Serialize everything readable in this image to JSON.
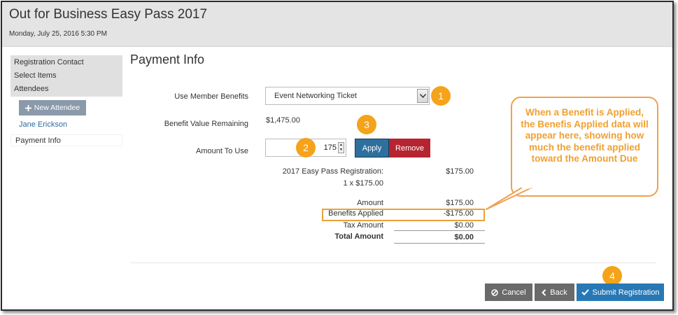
{
  "app": {
    "title": "Out for Business Easy Pass 2017",
    "datetime": "Monday, July 25, 2016 5:30 PM"
  },
  "sidebar": {
    "items": [
      {
        "label": "Registration Contact"
      },
      {
        "label": "Select Items"
      },
      {
        "label": "Attendees"
      }
    ],
    "new_attendee_label": "New Attendee",
    "attendee_name": "Jane Erickson",
    "active_item": "Payment Info"
  },
  "main": {
    "title": "Payment Info",
    "member_benefits_label": "Use Member Benefits",
    "member_benefits_selected": "Event Networking Ticket",
    "benefit_remaining_label": "Benefit Value Remaining",
    "benefit_remaining_value": "$1,475.00",
    "amount_to_use_label": "Amount To Use",
    "amount_to_use_value": "175",
    "apply_label": "Apply",
    "remove_label": "Remove"
  },
  "summary": {
    "item_name": "2017 Easy Pass Registration:",
    "item_price": "$175.00",
    "item_qty": "1 x $175.00",
    "amount_label": "Amount",
    "amount_value": "$175.00",
    "benefits_label": "Benefits Applied",
    "benefits_value": "-$175.00",
    "tax_label": "Tax Amount",
    "tax_value": "$0.00",
    "total_label": "Total Amount",
    "total_value": "$0.00"
  },
  "actions": {
    "cancel_label": "Cancel",
    "back_label": "Back",
    "submit_label": "Submit Registration"
  },
  "annotations": {
    "steps": [
      "1",
      "2",
      "3",
      "4"
    ],
    "callout_text": "When a Benefit is Applied, the Benefis Applied data will appear here, showing how much the benefit applied toward the Amount Due"
  },
  "colors": {
    "apply": "#2f6f9e",
    "remove": "#b52430",
    "submit": "#2878b5",
    "badge": "#f5a31a",
    "callout": "#f0a050"
  }
}
